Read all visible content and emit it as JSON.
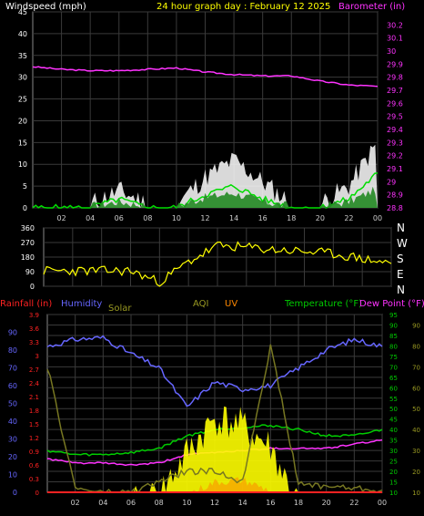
{
  "chart_data": [
    {
      "type": "line",
      "title": "24 hour graph day : February 12 2025",
      "x_tick_labels": [
        "02",
        "04",
        "06",
        "08",
        "10",
        "12",
        "14",
        "16",
        "18",
        "20",
        "22",
        "00"
      ],
      "left_axis": {
        "label": "Windspeed (mph)",
        "range": [
          0,
          45
        ],
        "ticks": [
          "0",
          "5",
          "10",
          "15",
          "20",
          "25",
          "30",
          "35",
          "40",
          "45"
        ]
      },
      "right_axis": {
        "label": "Barometer (in)",
        "range": [
          28.8,
          30.3
        ],
        "ticks": [
          "28.8",
          "28.9",
          "29",
          "29.1",
          "29.2",
          "29.3",
          "29.4",
          "29.5",
          "29.6",
          "29.7",
          "29.8",
          "29.9",
          "30",
          "30.1",
          "30.2"
        ]
      },
      "x_hours": [
        0,
        2,
        4,
        6,
        8,
        10,
        12,
        14,
        16,
        18,
        20,
        22,
        24
      ],
      "series": [
        {
          "role": "barometer",
          "color": "#ff33ff",
          "values": [
            29.88,
            29.86,
            29.85,
            29.85,
            29.86,
            29.87,
            29.84,
            29.82,
            29.81,
            29.81,
            29.77,
            29.74,
            29.73
          ]
        },
        {
          "role": "wind_gust",
          "color": "#ffffff",
          "values": [
            0,
            0,
            0,
            3,
            0,
            0,
            6,
            10,
            5,
            0,
            0,
            4,
            14
          ]
        },
        {
          "role": "wind_avg",
          "color": "#00dd00",
          "values": [
            0,
            0,
            0,
            2,
            0,
            0,
            3,
            5,
            2,
            0,
            0,
            2,
            8
          ]
        },
        {
          "role": "wind_range",
          "color": "#228822",
          "values": [
            0,
            0,
            0,
            1,
            0,
            0,
            2,
            3,
            1,
            0,
            0,
            1,
            4
          ]
        }
      ],
      "colors": {
        "windspeed_label": "#ffffff",
        "title": "#ffff00",
        "barometer_label": "#ff33ff",
        "grid": "#3a3a3a"
      }
    },
    {
      "type": "line",
      "y_tick_labels": [
        "0",
        "90",
        "180",
        "270",
        "360"
      ],
      "right_labels": [
        "N",
        "W",
        "S",
        "E",
        "N"
      ],
      "x_hours": [
        0,
        2,
        4,
        6,
        8,
        10,
        12,
        14,
        16,
        18,
        20,
        22,
        24
      ],
      "series": [
        {
          "role": "wind_direction",
          "color": "#ffff00",
          "values": [
            95,
            95,
            95,
            95,
            25,
            150,
            250,
            240,
            225,
            215,
            200,
            170,
            140
          ]
        }
      ]
    },
    {
      "type": "line",
      "legend": {
        "rainfall": "Rainfall (in)",
        "humidity": "Humidity",
        "solar": "Solar",
        "aqi": "AQI",
        "uv": "UV",
        "temperature": "Temperature (°F)",
        "dewpoint": "Dew Point (°F)"
      },
      "x_tick_labels": [
        "02",
        "04",
        "06",
        "08",
        "10",
        "12",
        "14",
        "16",
        "18",
        "20",
        "22",
        "00"
      ],
      "rain_axis_ticks": [
        "0",
        "0.3",
        "0.6",
        "0.9",
        "1.2",
        "1.5",
        "1.8",
        "2.1",
        "2.4",
        "2.7",
        "3",
        "3.3",
        "3.6",
        "3.9"
      ],
      "humidity_axis_ticks": [
        "0",
        "10",
        "20",
        "30",
        "40",
        "50",
        "60",
        "70",
        "80",
        "90"
      ],
      "temp_axis_ticks": [
        "10",
        "15",
        "20",
        "25",
        "30",
        "35",
        "40",
        "45",
        "50",
        "55",
        "60",
        "65",
        "70",
        "75",
        "80",
        "85",
        "90",
        "95"
      ],
      "far_right_ticks": [
        "10",
        "20",
        "30",
        "40",
        "50",
        "60",
        "70",
        "80",
        "90"
      ],
      "x_hours": [
        0,
        2,
        4,
        6,
        8,
        10,
        12,
        14,
        16,
        18,
        20,
        22,
        24
      ],
      "series": [
        {
          "role": "humidity",
          "color": "#6666ff",
          "axis": "humidity",
          "values": [
            82,
            86,
            87,
            78,
            70,
            48,
            62,
            58,
            60,
            70,
            80,
            86,
            82
          ]
        },
        {
          "role": "temperature",
          "color": "#00cc00",
          "axis": "temp",
          "values": [
            30,
            28,
            28,
            29,
            31,
            37,
            40,
            41,
            42,
            40,
            37,
            37,
            40
          ]
        },
        {
          "role": "dewpoint",
          "color": "#ff33ff",
          "axis": "temp",
          "values": [
            26,
            24,
            24,
            23,
            24,
            28,
            29,
            30,
            31,
            31,
            31,
            33,
            35
          ]
        },
        {
          "role": "solar",
          "color": "#ffff00",
          "axis": "temp",
          "values": [
            0,
            0,
            0,
            0,
            5,
            25,
            42,
            38,
            28,
            0,
            0,
            0,
            0
          ]
        },
        {
          "role": "uv",
          "color": "#ff8800",
          "axis": "temp",
          "values": [
            0,
            0,
            0,
            0,
            2,
            8,
            14,
            15,
            10,
            0,
            0,
            0,
            0
          ]
        },
        {
          "role": "aqi",
          "color": "#777722",
          "axis": "temp",
          "values": [
            70,
            12,
            10,
            10,
            15,
            20,
            20,
            15,
            80,
            14,
            13,
            12,
            11
          ]
        },
        {
          "role": "rainfall",
          "color": "#ff2222",
          "axis": "rain",
          "values": [
            0,
            0,
            0,
            0,
            0,
            0,
            0,
            0,
            0,
            0,
            0,
            0,
            0
          ]
        }
      ],
      "colors": {
        "rainfall": "#ff2222",
        "humidity": "#6666ff",
        "solar": "#999922",
        "aqi": "#999922",
        "uv": "#ff8800",
        "temperature": "#00cc00",
        "dewpoint": "#ff33ff"
      }
    }
  ]
}
